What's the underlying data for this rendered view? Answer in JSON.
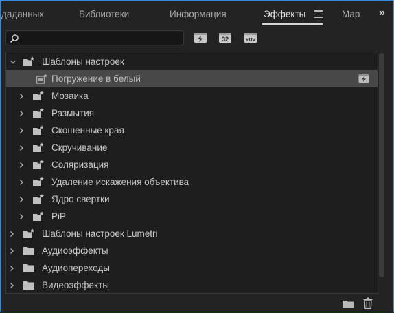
{
  "tabs": [
    {
      "label": "даданных",
      "active": false
    },
    {
      "label": "Библиотеки",
      "active": false
    },
    {
      "label": "Информация",
      "active": false
    },
    {
      "label": "Эффекты",
      "active": true
    },
    {
      "label": "Мар",
      "active": false
    }
  ],
  "more_label": "»",
  "search": {
    "value": "",
    "placeholder": ""
  },
  "filter_buttons": [
    {
      "icon": "accelerated-effects-icon",
      "label": ""
    },
    {
      "label": "32"
    },
    {
      "label": "YUV"
    }
  ],
  "tree": [
    {
      "label": "Шаблоны настроек",
      "expanded": true,
      "folder": "preset-folder"
    },
    {
      "label": "Погружение в белый",
      "selected": true,
      "item": "preset-item"
    },
    {
      "label": "Мозаика",
      "folder": "preset-folder"
    },
    {
      "label": "Размытия",
      "folder": "preset-folder"
    },
    {
      "label": "Скошенные края",
      "folder": "preset-folder"
    },
    {
      "label": "Скручивание",
      "folder": "preset-folder"
    },
    {
      "label": "Соляризация",
      "folder": "preset-folder"
    },
    {
      "label": "Удаление искажения объектива",
      "folder": "preset-folder"
    },
    {
      "label": "Ядро свертки",
      "folder": "preset-folder"
    },
    {
      "label": "PiP",
      "folder": "preset-folder"
    },
    {
      "label": "Шаблоны настроек Lumetri",
      "folder": "preset-folder"
    },
    {
      "label": "Аудиоэффекты",
      "folder": "folder"
    },
    {
      "label": "Аудиопереходы",
      "folder": "folder"
    },
    {
      "label": "Видеоэффекты",
      "folder": "folder"
    }
  ],
  "colors": {
    "accent_border": "#2d8ceb",
    "selected_row": "#484848"
  }
}
